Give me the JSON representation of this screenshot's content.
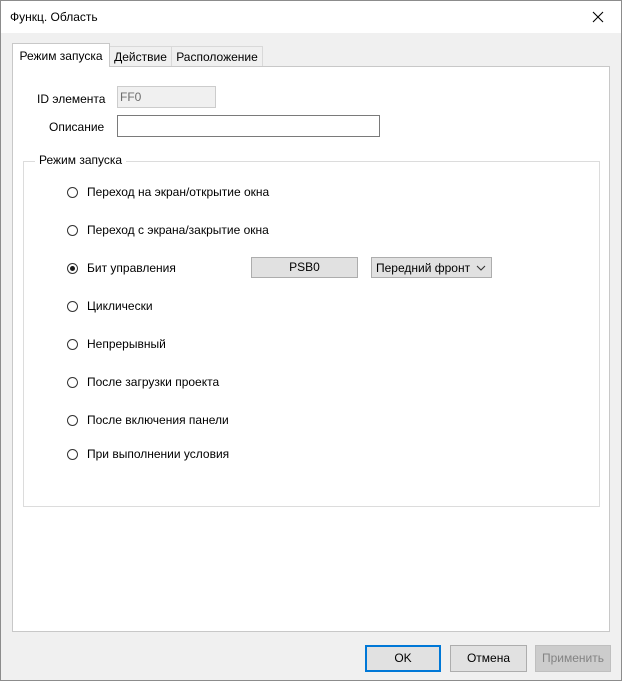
{
  "window": {
    "title": "Функц. Область"
  },
  "tabs": [
    {
      "label": "Режим запуска",
      "active": true
    },
    {
      "label": "Действие",
      "active": false
    },
    {
      "label": "Расположение",
      "active": false
    }
  ],
  "form": {
    "id_label": "ID элемента",
    "id_value": "FF0",
    "description_label": "Описание",
    "description_value": ""
  },
  "launch_mode": {
    "group_title": "Режим запуска",
    "options": [
      {
        "label": "Переход на экран/открытие окна",
        "checked": false
      },
      {
        "label": "Переход с экрана/закрытие окна",
        "checked": false
      },
      {
        "label": "Бит управления",
        "checked": true
      },
      {
        "label": "Циклически",
        "checked": false
      },
      {
        "label": "Непрерывный",
        "checked": false
      },
      {
        "label": "После загрузки проекта",
        "checked": false
      },
      {
        "label": "После включения панели",
        "checked": false
      },
      {
        "label": "При выполнении условия",
        "checked": false
      }
    ],
    "control_bit_address": "PSB0",
    "edge_select": "Передний фронт"
  },
  "footer": {
    "ok_label": "OK",
    "cancel_label": "Отмена",
    "apply_label": "Применить"
  },
  "icons": {
    "close": "close-icon",
    "dropdown": "chevron-down-icon"
  },
  "colors": {
    "window_bg": "#f0f0f0",
    "panel_bg": "#ffffff",
    "default_button_border": "#0078d7",
    "disabled_text": "#838383"
  }
}
